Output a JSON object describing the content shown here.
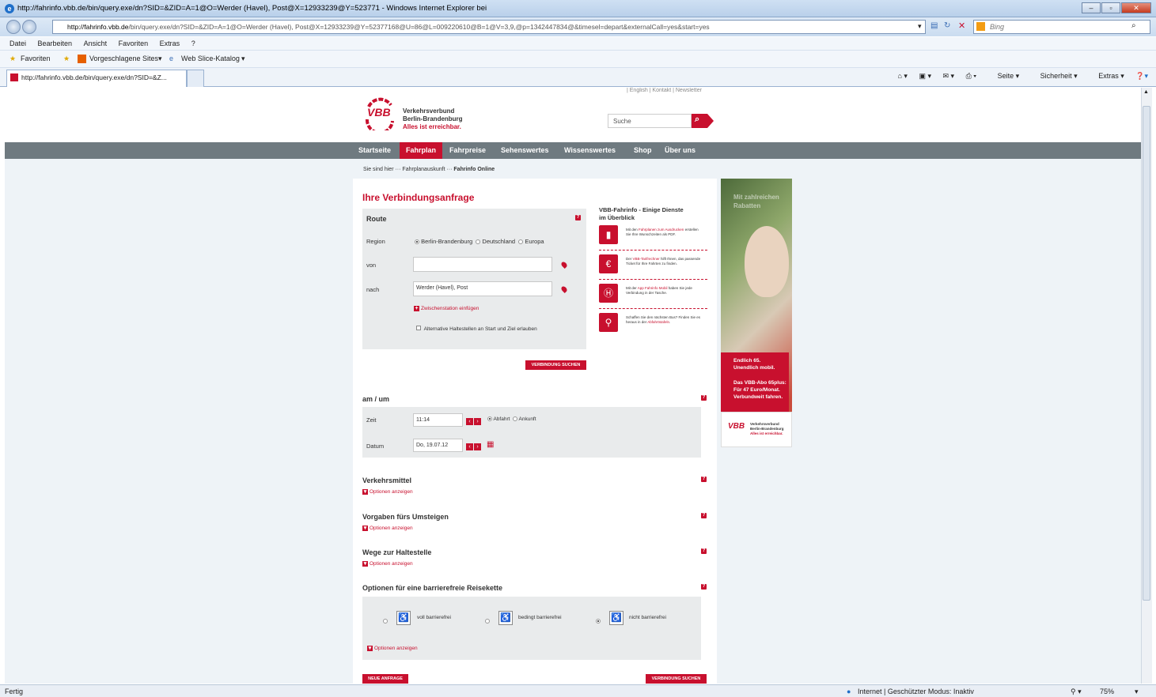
{
  "window": {
    "title": "http://fahrinfo.vbb.de/bin/query.exe/dn?SID=&ZID=A=1@O=Werder (Havel), Post@X=12933239@Y=523771 - Windows Internet Explorer bei"
  },
  "browser": {
    "address_host": "http://fahrinfo.vbb.de",
    "address_path": "/bin/query.exe/dn?SID=&ZID=A=1@O=Werder (Havel), Post@X=12933239@Y=52377168@U=86@L=009220610@B=1@V=3,9,@p=1342447834@&timesel=depart&externalCall=yes&start=yes",
    "search_placeholder": "Bing",
    "menu": [
      "Datei",
      "Bearbeiten",
      "Ansicht",
      "Favoriten",
      "Extras",
      "?"
    ],
    "fav_label": "Favoriten",
    "fav_suggested": "Vorgeschlagene Sites",
    "fav_webslice": "Web Slice-Katalog",
    "tab_title": "http://fahrinfo.vbb.de/bin/query.exe/dn?SID=&Z...",
    "cmd_page": "Seite",
    "cmd_security": "Sicherheit",
    "cmd_extras": "Extras"
  },
  "site": {
    "brand1": "Verkehrsverbund",
    "brand2": "Berlin-Brandenburg",
    "brand3": "Alles ist erreichbar.",
    "logo_text": "VBB",
    "toplinks": "|  English  |  Kontakt  |  Newsletter",
    "search_placeholder": "Suche",
    "nav": [
      "Startseite",
      "Fahrplan",
      "Fahrpreise",
      "Sehenswertes",
      "Wissenswertes",
      "Shop",
      "Über uns"
    ],
    "crumb_prefix": "Sie sind hier",
    "crumb_mid": "Fahrplanauskunft",
    "crumb_current": "Fahrinfo Online"
  },
  "form": {
    "title": "Ihre Verbindungsanfrage",
    "route_head": "Route",
    "region_label": "Region",
    "regions": [
      "Berlin-Brandenburg",
      "Deutschland",
      "Europa"
    ],
    "from_label": "von",
    "from_value": "",
    "to_label": "nach",
    "to_value": "Werder (Havel), Post",
    "add_via": "Zwischenstation einfügen",
    "alt_stops": "Alternative Haltestellen an Start und Ziel erlauben",
    "search_btn": "VERBINDUNG SUCHEN",
    "time_head": "am / um",
    "time_label": "Zeit",
    "time_value": "11:14",
    "depart": "Abfahrt",
    "arrive": "Ankunft",
    "date_label": "Datum",
    "date_value": "Do, 19.07.12",
    "transport_head": "Verkehrsmittel",
    "transfer_head": "Vorgaben fürs Umsteigen",
    "walk_head": "Wege zur Haltestelle",
    "barrier_head": "Optionen für eine barrierefreie Reisekette",
    "show_options": "Optionen anzeigen",
    "barrier_opts": [
      "voll barrierefrei",
      "bedingt barrierefrei",
      "nicht barrierefrei"
    ],
    "new_btn": "NEUE ANFRAGE"
  },
  "services": {
    "head1": "VBB-Fahrinfo - Einige Dienste",
    "head2": "im Überblick",
    "s1a": "Mit den ",
    "s1b": "Fahrplanen zum Ausdrucken",
    "s1c": " erstellen Sie Ihre Wunschzeiten als PDF.",
    "s2a": "Der ",
    "s2b": "VBB-Tarifrechner",
    "s2c": " hilft Ihnen, das passende Ticket für Ihre Fahrten zu finden.",
    "s3a": "Mit der ",
    "s3b": "App Fahrinfo Mobil",
    "s3c": " haben Sie jede Verbindung in der Tasche.",
    "s4a": "Schaffen Sie den nächsten Bus? Finden Sie es heraus in der ",
    "s4b": "Abfahrtstafeln",
    "s4c": "."
  },
  "ad": {
    "top": "Mit zahlreichen Rabatten",
    "l1": "Endlich 65.",
    "l2": "Unendlich mobil.",
    "l3": "Das VBB-Abo 65plus:",
    "l4": "Für 47 Euro/Monat.",
    "l5": "Verbundweit fahren.",
    "logo": "VBB",
    "b1": "Verkehrsverbund",
    "b2": "Berlin-Brandenburg",
    "b3": "Alles ist erreichbar."
  },
  "statusbar": {
    "left": "Fertig",
    "zone": "Internet | Geschützter Modus: Inaktiv",
    "zoom": "75%"
  },
  "colors": {
    "accent": "#c8102e",
    "nav": "#6f7a80"
  }
}
